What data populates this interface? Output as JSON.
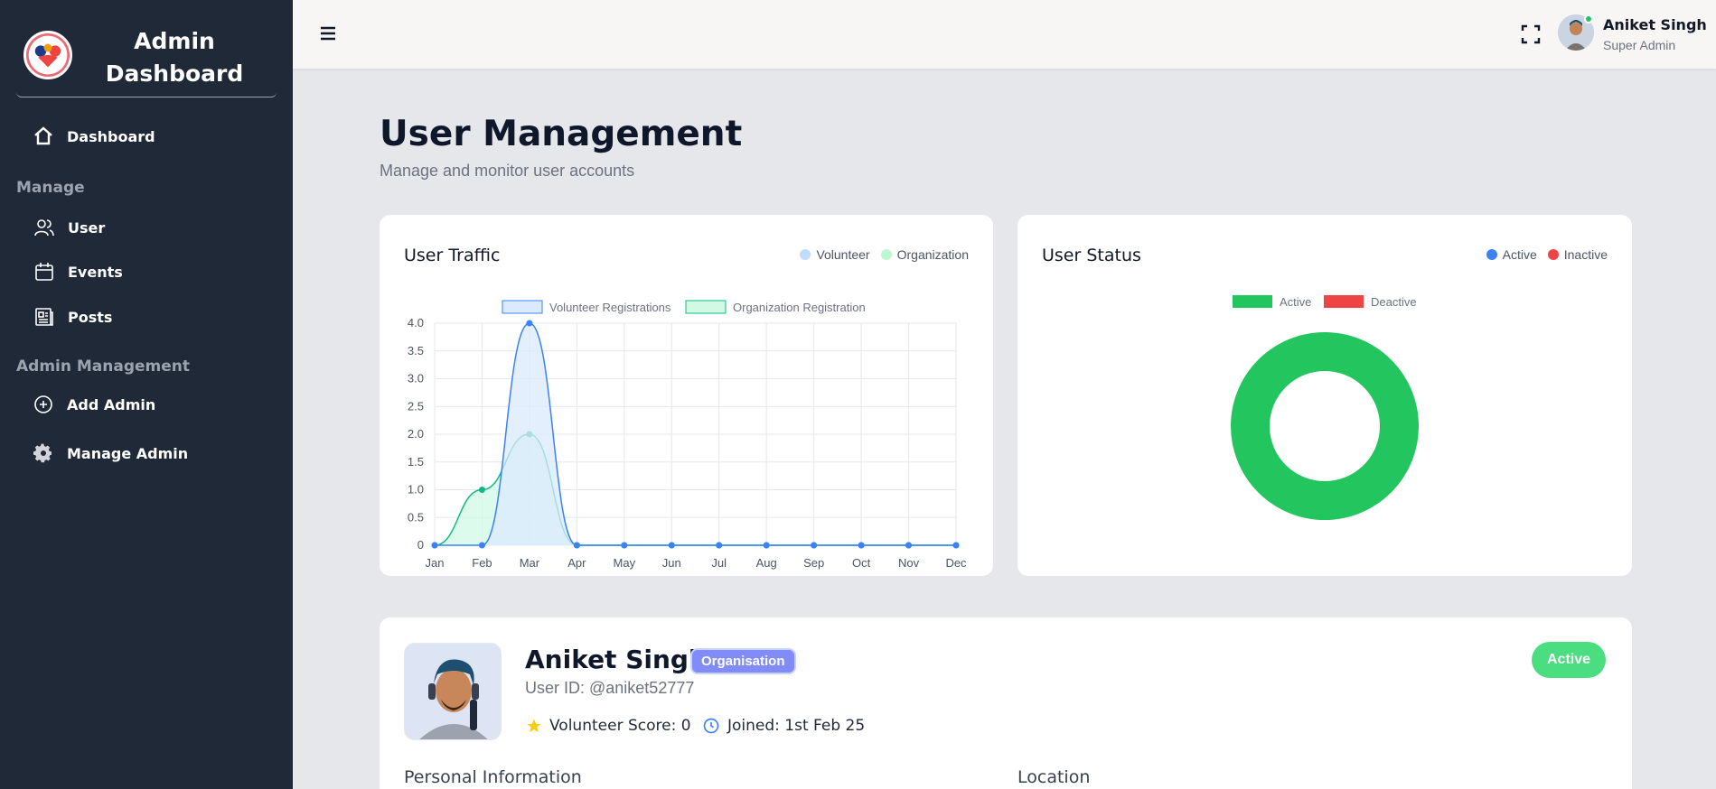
{
  "sidebar": {
    "brand_line1": "Admin",
    "brand_line2": "Dashboard",
    "dashboard": "Dashboard",
    "section_manage": "Manage",
    "user": "User",
    "events": "Events",
    "posts": "Posts",
    "section_admin": "Admin Management",
    "add_admin": "Add Admin",
    "manage_admin": "Manage Admin"
  },
  "topbar": {
    "user_name": "Aniket Singh",
    "user_role": "Super Admin"
  },
  "page": {
    "title": "User Management",
    "subtitle": "Manage and monitor user accounts"
  },
  "traffic_card": {
    "title": "User Traffic",
    "legend": [
      "Volunteer",
      "Organization"
    ],
    "legend_colors": [
      "#bfdbfe",
      "#bbf7d0"
    ]
  },
  "status_card": {
    "title": "User Status",
    "legend": [
      "Active",
      "Inactive"
    ],
    "legend_colors": [
      "#3b82f6",
      "#ef4444"
    ]
  },
  "chart_data": [
    {
      "type": "area",
      "legend": [
        "Volunteer Registrations",
        "Organization Registration"
      ],
      "x": [
        "Jan",
        "Feb",
        "Mar",
        "Apr",
        "May",
        "Jun",
        "Jul",
        "Aug",
        "Sep",
        "Oct",
        "Nov",
        "Dec"
      ],
      "series": [
        {
          "name": "Volunteer Registrations",
          "values": [
            0,
            0,
            4,
            0,
            0,
            0,
            0,
            0,
            0,
            0,
            0,
            0
          ],
          "color": "#3b82f6",
          "fill": "#dbeafe"
        },
        {
          "name": "Organization Registration",
          "values": [
            0,
            1,
            2,
            0,
            0,
            0,
            0,
            0,
            0,
            0,
            0,
            0
          ],
          "color": "#10b981",
          "fill": "#d1fae5"
        }
      ],
      "yticks": [
        "0",
        "0.5",
        "1.0",
        "1.5",
        "2.0",
        "2.5",
        "3.0",
        "3.5",
        "4.0"
      ],
      "ylim": [
        0,
        4
      ],
      "grid": true,
      "legend_position": "top"
    },
    {
      "type": "pie",
      "legend": [
        "Active",
        "Deactive"
      ],
      "colors": [
        "#22c55e",
        "#ef4444"
      ],
      "values": [
        1,
        0
      ],
      "legend_position": "top"
    }
  ],
  "profile": {
    "name": "Aniket Singh",
    "type_badge": "Organisation",
    "user_id": "User ID: @aniket52777",
    "score": "Volunteer Score: 0",
    "joined": "Joined: 1st Feb 25",
    "status": "Active",
    "personal_heading": "Personal Information",
    "location_heading": "Location"
  }
}
